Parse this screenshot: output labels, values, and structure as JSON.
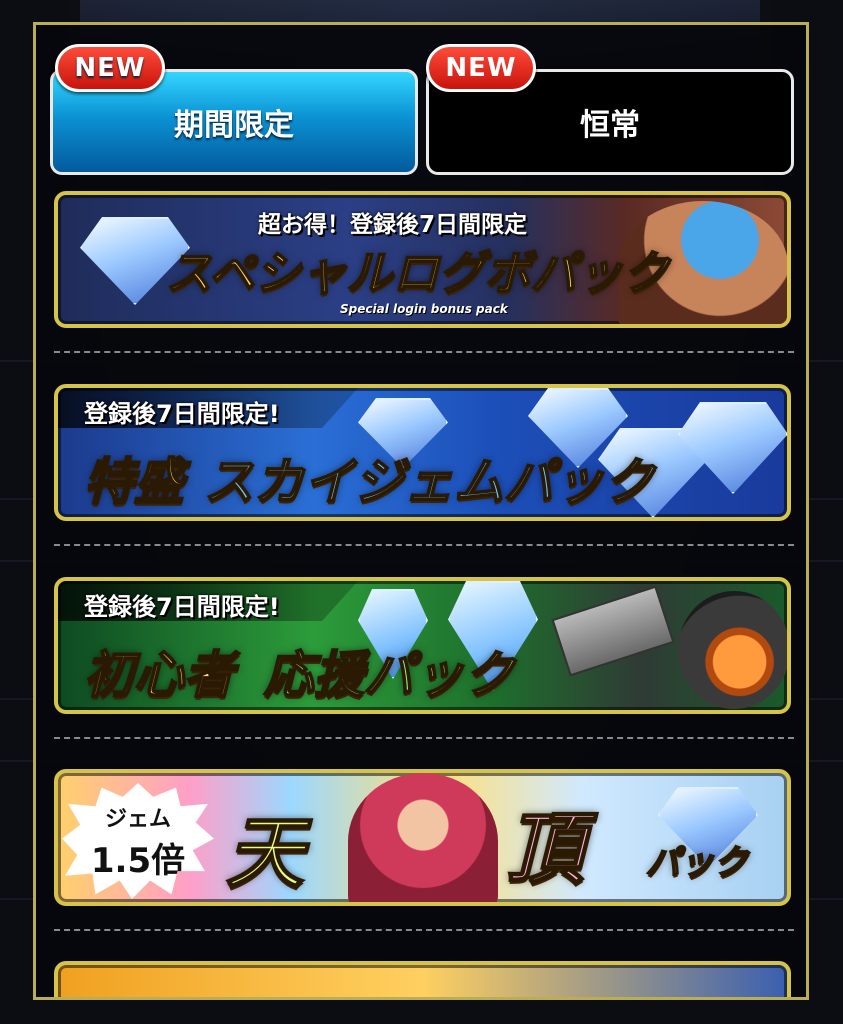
{
  "tabs": [
    {
      "label": "期間限定",
      "badge": "NEW",
      "active": true
    },
    {
      "label": "恒常",
      "badge": "NEW",
      "active": false
    }
  ],
  "banners": [
    {
      "tagline": "超お得！登録後7日間限定",
      "title": "スペシャルログボパック",
      "subtitle": "Special login bonus pack"
    },
    {
      "tagline": "登録後7日間限定!",
      "title_part1": "特盛",
      "title_part2": "スカイジェムパック"
    },
    {
      "tagline": "登録後7日間限定!",
      "title_part1": "初心者",
      "title_part2": "応援パック"
    },
    {
      "badge_top": "ジェム",
      "badge_value": "1.5倍",
      "title_part1": "天",
      "title_part2": "頂",
      "title_part3": "パック"
    }
  ],
  "colors": {
    "frame": "#b9ad55",
    "tab_active": "#0b92d4",
    "badge_red": "#d8180e",
    "banner_border": "#d6c34a"
  }
}
